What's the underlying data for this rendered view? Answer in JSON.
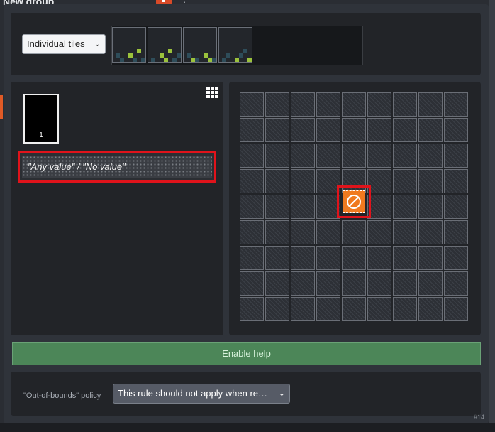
{
  "window": {
    "title": "New group"
  },
  "top": {
    "mode_select": {
      "value": "Individual tiles"
    }
  },
  "left": {
    "swatch": {
      "label": "1"
    },
    "any_value_label": "\"Any value\" / \"No value\""
  },
  "help": {
    "label": "Enable help"
  },
  "out_of_bounds": {
    "label": "\"Out-of-bounds\" policy",
    "select_value": "This rule should not apply when re…"
  },
  "footer": {
    "tag": "#14"
  },
  "colors": {
    "accent_orange": "#f07a1f",
    "highlight_red": "#e0131b",
    "help_green": "#4c8658",
    "tile_green": "#9bc23c",
    "tile_teal": "#2e4d5a"
  },
  "icons": {
    "grid": "grid-icon",
    "chevron": "chevron-down-icon",
    "no_entry": "no-entry-icon",
    "kebab": "kebab-menu-icon"
  }
}
